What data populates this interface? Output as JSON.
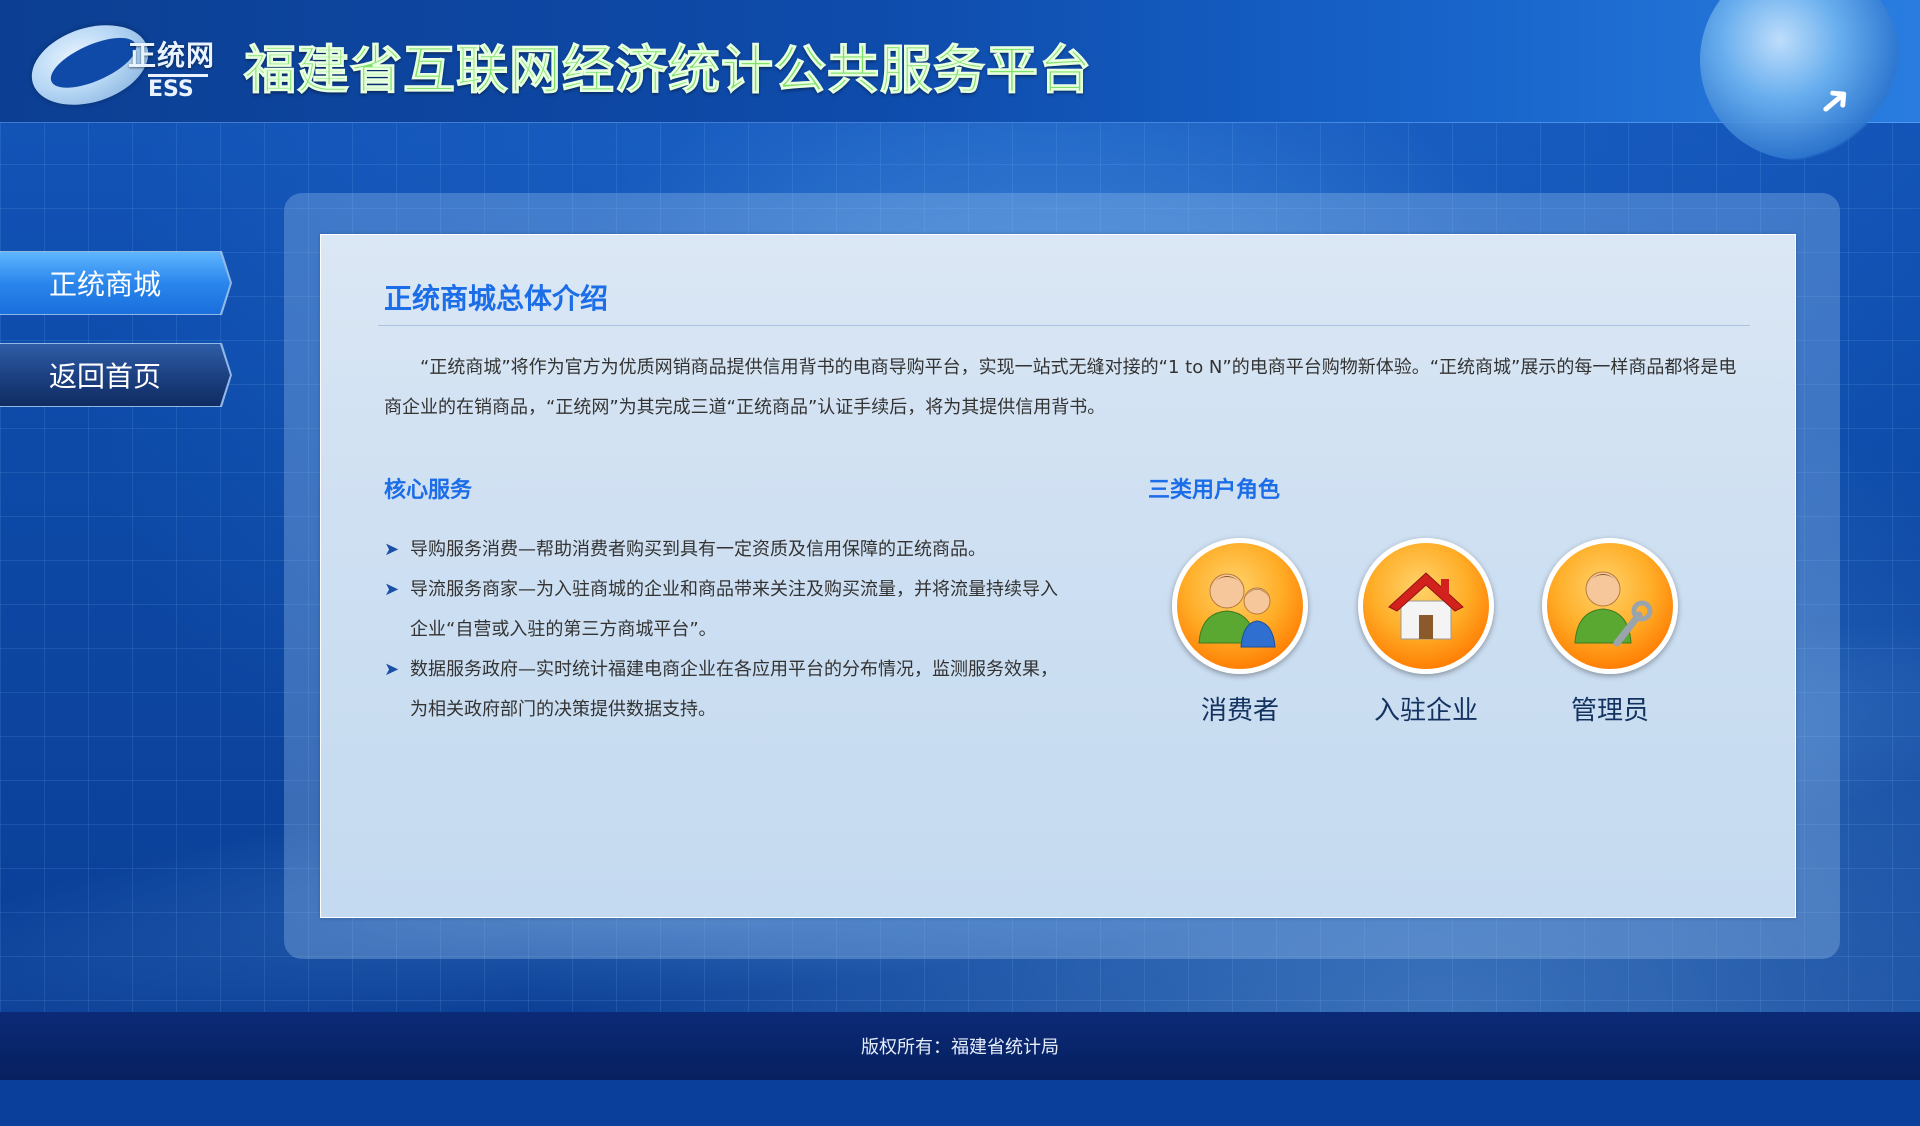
{
  "header": {
    "logo_cn": "正统网",
    "logo_en": "ESS",
    "title": "福建省互联网经济统计公共服务平台"
  },
  "nav": {
    "items": [
      {
        "label": "正统商城",
        "active": true
      },
      {
        "label": "返回首页",
        "active": false
      }
    ]
  },
  "main": {
    "intro_title": "正统商城总体介绍",
    "intro_text": "“正统商城”将作为官方为优质网销商品提供信用背书的电商导购平台，实现一站式无缝对接的“1 to N”的电商平台购物新体验。“正统商城”展示的每一样商品都将是电商企业的在销商品，“正统网”为其完成三道“正统商品”认证手续后，将为其提供信用背书。",
    "services_title": "核心服务",
    "services": [
      "导购服务消费—帮助消费者购买到具有一定资质及信用保障的正统商品。",
      "导流服务商家—为入驻商城的企业和商品带来关注及购买流量，并将流量持续导入企业“自营或入驻的第三方商城平台”。",
      "数据服务政府—实时统计福建电商企业在各应用平台的分布情况，监测服务效果，为相关政府部门的决策提供数据支持。"
    ],
    "roles_title": "三类用户角色",
    "roles": [
      {
        "label": "消费者",
        "icon": "users-icon"
      },
      {
        "label": "入驻企业",
        "icon": "house-icon"
      },
      {
        "label": "管理员",
        "icon": "admin-wrench-icon"
      }
    ]
  },
  "footer": {
    "copyright": "版权所有：福建省统计局"
  },
  "colors": {
    "accent": "#1b6de8",
    "header_title": "#7fe06a",
    "footer_bg": "#07205f"
  }
}
